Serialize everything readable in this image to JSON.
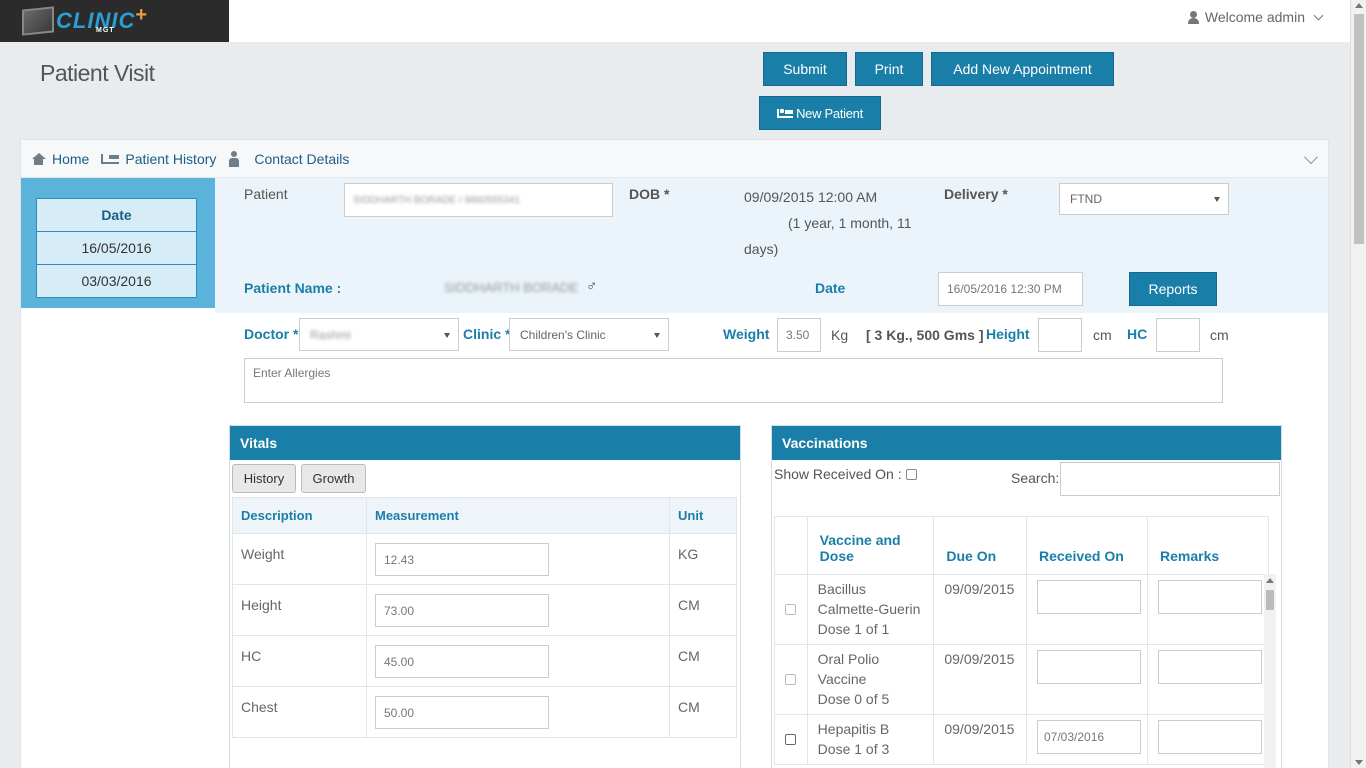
{
  "app": {
    "logo_text": "CLINIC",
    "logo_sub": "MGT"
  },
  "header": {
    "welcome": "Welcome admin"
  },
  "page": {
    "title": "Patient Visit"
  },
  "actions": {
    "submit": "Submit",
    "print": "Print",
    "add_appointment": "Add New Appointment",
    "new_patient": "New Patient"
  },
  "breadcrumb": {
    "home": "Home",
    "history": "Patient History",
    "contact": "Contact Details"
  },
  "dates": {
    "header": "Date",
    "items": [
      "16/05/2016",
      "03/03/2016"
    ]
  },
  "patient": {
    "label": "Patient",
    "value": "SIDDHARTH    BORADE / 9860555341",
    "dob_label": "DOB *",
    "dob_value": "09/09/2015 12:00 AM",
    "age_line1": "(1 year, 1 month, 11",
    "age_line2": "days)",
    "delivery_label": "Delivery *",
    "delivery_value": "FTND",
    "name_label": "Patient Name :",
    "name_value": "SIDDHARTH BORADE",
    "gender_symbol": "♂",
    "date_label": "Date",
    "date_value": "16/05/2016 12:30 PM",
    "reports": "Reports"
  },
  "visit": {
    "doctor_label": "Doctor *",
    "doctor_value": "Rashmi",
    "clinic_label": "Clinic *",
    "clinic_value": "Children's Clinic",
    "weight_label": "Weight",
    "weight_value": "3.50",
    "weight_unit": "Kg",
    "weight_desc": "[ 3 Kg., 500 Gms ]",
    "height_label": "Height",
    "height_unit": "cm",
    "hc_label": "HC",
    "hc_unit": "cm",
    "allergies_placeholder": "Enter Allergies"
  },
  "vitals": {
    "title": "Vitals",
    "tabs": [
      "History",
      "Growth"
    ],
    "columns": [
      "Description",
      "Measurement",
      "Unit"
    ],
    "rows": [
      {
        "desc": "Weight",
        "value": "12.43",
        "unit": "KG"
      },
      {
        "desc": "Height",
        "value": "73.00",
        "unit": "CM"
      },
      {
        "desc": "HC",
        "value": "45.00",
        "unit": "CM"
      },
      {
        "desc": "Chest",
        "value": "50.00",
        "unit": "CM"
      }
    ]
  },
  "vaccinations": {
    "title": "Vaccinations",
    "show_received": "Show Received On :",
    "search_label": "Search:",
    "columns": [
      "Vaccine and Dose",
      "Due On",
      "Received On",
      "Remarks"
    ],
    "rows": [
      {
        "name": [
          "Bacillus",
          "Calmette-Guerin",
          "Dose 1 of 1"
        ],
        "due": "09/09/2015",
        "received": ""
      },
      {
        "name": [
          "Oral Polio",
          "Vaccine",
          "Dose 0 of 5"
        ],
        "due": "09/09/2015",
        "received": ""
      },
      {
        "name": [
          "Hepapitis B",
          "Dose 1 of 3"
        ],
        "due": "09/09/2015",
        "received": "07/03/2016"
      }
    ]
  },
  "colors": {
    "primary": "#1a7fa8",
    "sidebar": "#5bb3dc",
    "band": "#eaf4fa",
    "logo_bg": "#2b2b2b"
  }
}
